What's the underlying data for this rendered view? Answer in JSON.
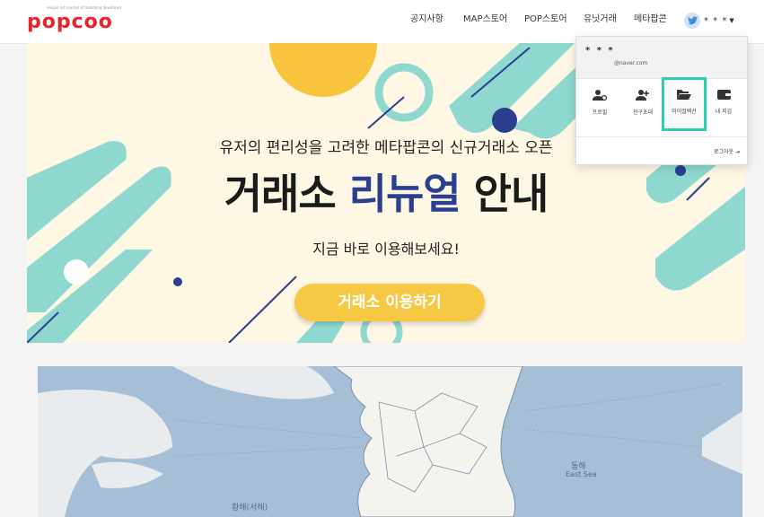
{
  "header": {
    "logo_text": "popcoo",
    "logo_tagline": "unique art market of mokdong downtown",
    "nav": [
      "공지사항",
      "MAP스토어",
      "POP스토어",
      "유닛거래",
      "메타팝콘"
    ],
    "user": {
      "name": "* * *",
      "avatar_icon": "twitter-bird-icon"
    }
  },
  "banner": {
    "subheadline": "유저의 편리성을 고려한 메타팝콘의 신규거래소 오픈",
    "headline_pre": "거래소 ",
    "headline_accent": "리뉴얼",
    "headline_post": " 안내",
    "tagline": "지금 바로 이용해보세요!",
    "cta_label": "거래소 이용하기",
    "colors": {
      "accent_navy": "#2a3f8f",
      "cta_yellow": "#f7c843",
      "mint": "#8ed8d0",
      "background": "#fdf7e3"
    }
  },
  "map": {
    "labels": [
      "황해(서해)",
      "동해",
      "East Sea"
    ]
  },
  "dropdown": {
    "user_name": "* * *",
    "email": "@naver.com",
    "items": [
      {
        "label": "프로필",
        "icon": "profile-icon"
      },
      {
        "label": "친구초대",
        "icon": "add-friend-icon"
      },
      {
        "label": "마이컬렉션",
        "icon": "folder-open-icon",
        "highlighted": true
      },
      {
        "label": "내 지갑",
        "icon": "wallet-icon"
      }
    ],
    "logout_label": "로그아웃"
  }
}
